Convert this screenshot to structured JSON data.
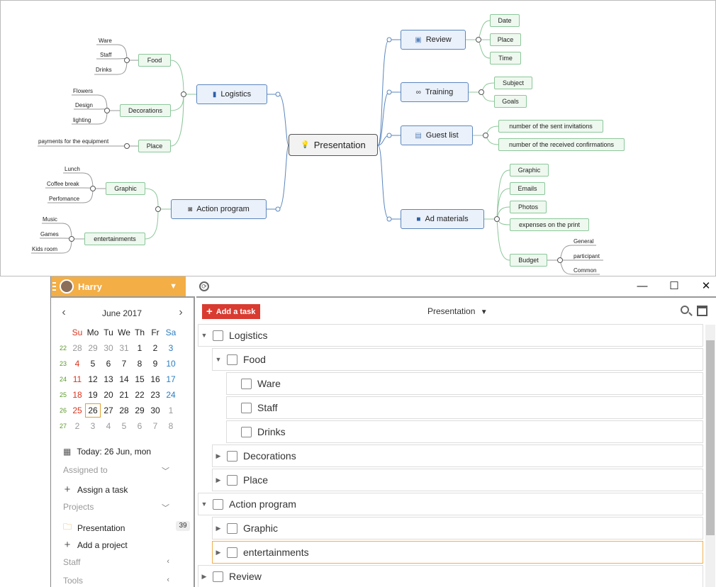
{
  "mindmap": {
    "root": "Presentation",
    "logistics": {
      "label": "Logistics",
      "food": {
        "label": "Food",
        "leaves": [
          "Ware",
          "Staff",
          "Drinks"
        ]
      },
      "decorations": {
        "label": "Decorations",
        "leaves": [
          "Flowers",
          "Design",
          "lighting"
        ]
      },
      "place": {
        "label": "Place",
        "leaves": [
          "payments for the equipment"
        ]
      }
    },
    "action_program": {
      "label": "Action program",
      "graphic": {
        "label": "Graphic",
        "leaves": [
          "Lunch",
          "Coffee break",
          "Perfomance"
        ]
      },
      "entertainments": {
        "label": "entertainments",
        "leaves": [
          "Music",
          "Games",
          "Kids room"
        ]
      }
    },
    "review": {
      "label": "Review",
      "children": [
        "Date",
        "Place",
        "Time"
      ]
    },
    "training": {
      "label": "Training",
      "children": [
        "Subject",
        "Goals"
      ]
    },
    "guest_list": {
      "label": "Guest list",
      "children": [
        "number of the sent invitations",
        "number of the received confirmations"
      ]
    },
    "ad_materials": {
      "label": "Ad materials",
      "children": [
        "Graphic",
        "Emails",
        "Photos",
        "expenses on the print"
      ],
      "budget": {
        "label": "Budget",
        "leaves": [
          "General",
          "participant",
          "Common"
        ]
      }
    }
  },
  "app": {
    "user": "Harry",
    "calendar": {
      "title": "June 2017",
      "weekdays": [
        "Su",
        "Mo",
        "Tu",
        "We",
        "Th",
        "Fr",
        "Sa"
      ],
      "weeks": [
        {
          "wk": "22",
          "days": [
            "28",
            "29",
            "30",
            "31",
            "1",
            "2",
            "3"
          ]
        },
        {
          "wk": "23",
          "days": [
            "4",
            "5",
            "6",
            "7",
            "8",
            "9",
            "10"
          ]
        },
        {
          "wk": "24",
          "days": [
            "11",
            "12",
            "13",
            "14",
            "15",
            "16",
            "17"
          ]
        },
        {
          "wk": "25",
          "days": [
            "18",
            "19",
            "20",
            "21",
            "22",
            "23",
            "24"
          ]
        },
        {
          "wk": "26",
          "days": [
            "25",
            "26",
            "27",
            "28",
            "29",
            "30",
            "1"
          ]
        },
        {
          "wk": "27",
          "days": [
            "2",
            "3",
            "4",
            "5",
            "6",
            "7",
            "8"
          ]
        }
      ]
    },
    "today": "Today: 26 Jun, mon",
    "assigned_to": "Assigned to",
    "assign_task": "Assign a task",
    "projects": "Projects",
    "project_name": "Presentation",
    "project_count": "39",
    "add_project": "Add a project",
    "staff": "Staff",
    "tools": "Tools",
    "add_task": "Add a task",
    "project_selector": "Presentation",
    "tasks": [
      "Logistics",
      "Food",
      "Ware",
      "Staff",
      "Drinks",
      "Decorations",
      "Place",
      "Action program",
      "Graphic",
      "entertainments",
      "Review"
    ]
  },
  "colors": {
    "accent_orange": "#f3ae45",
    "add_button_red": "#d93b30",
    "main_node_border": "#5b86bd",
    "sub_node_border": "#8cc79a"
  }
}
